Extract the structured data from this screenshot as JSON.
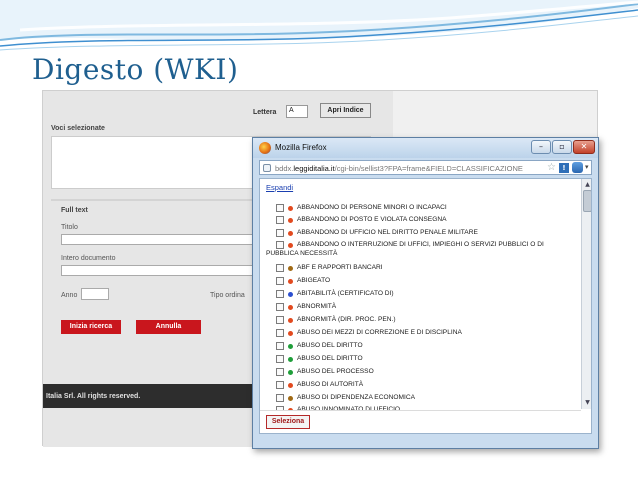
{
  "slide": {
    "title": "Digesto (WKI)"
  },
  "page": {
    "lettera_label": "Lettera",
    "lettera_value": "A",
    "apri_indice": "Apri Indice",
    "voci_selezionate": "Voci selezionate",
    "full_text": "Full text",
    "titolo": "Titolo",
    "intero_documento": "Intero documento",
    "anno": "Anno",
    "tipo_ordina": "Tipo ordina",
    "inizia_ricerca": "Inizia ricerca",
    "annulla": "Annulla",
    "footer": "Italia Srl. All rights reserved."
  },
  "popup": {
    "window_title": "Mozilla Firefox",
    "url_prefix": "bddx.",
    "url_host": "leggiditalia.it",
    "url_rest": "/cgi-bin/sellist3?FPA=frame&FIELD=CLASSIFICAZIONE",
    "espandi": "Espandi",
    "seleziona": "Seleziona",
    "items": [
      {
        "label": "ABBANDONO DI PERSONE MINORI O INCAPACI",
        "color": "#e24a1f"
      },
      {
        "label": "ABBANDONO DI POSTO E VIOLATA CONSEGNA",
        "color": "#e24a1f"
      },
      {
        "label": "ABBANDONO DI UFFICIO NEL DIRITTO PENALE MILITARE",
        "color": "#e24a1f"
      },
      {
        "label": "ABBANDONO O INTERRUZIONE DI UFFICI, IMPIEGHI O SERVIZI PUBBLICI O DI",
        "label_cont": "PUBBLICA NECESSITÀ",
        "color": "#e24a1f"
      },
      {
        "label": "ABF E RAPPORTI BANCARI",
        "color": "#a06a15"
      },
      {
        "label": "ABIGEATO",
        "color": "#e24a1f"
      },
      {
        "label": "ABITABILITÀ (CERTIFICATO DI)",
        "color": "#2b4fd0"
      },
      {
        "label": "ABNORMITÀ",
        "color": "#e24a1f"
      },
      {
        "label": "ABNORMITÀ (DIR. PROC. PEN.)",
        "color": "#e24a1f"
      },
      {
        "label": "ABUSO DEI MEZZI DI CORREZIONE E DI DISCIPLINA",
        "color": "#e24a1f"
      },
      {
        "label": "ABUSO DEL DIRITTO",
        "color": "#1f9e3a"
      },
      {
        "label": "ABUSO DEL DIRITTO",
        "color": "#1f9e3a"
      },
      {
        "label": "ABUSO DEL PROCESSO",
        "color": "#1f9e3a"
      },
      {
        "label": "ABUSO DI AUTORITÀ",
        "color": "#e24a1f"
      },
      {
        "label": "ABUSO DI DIPENDENZA ECONOMICA",
        "color": "#a06a15"
      },
      {
        "label": "ABUSO INNOMINATO DI UFFICIO",
        "color": "#e24a1f"
      }
    ]
  }
}
